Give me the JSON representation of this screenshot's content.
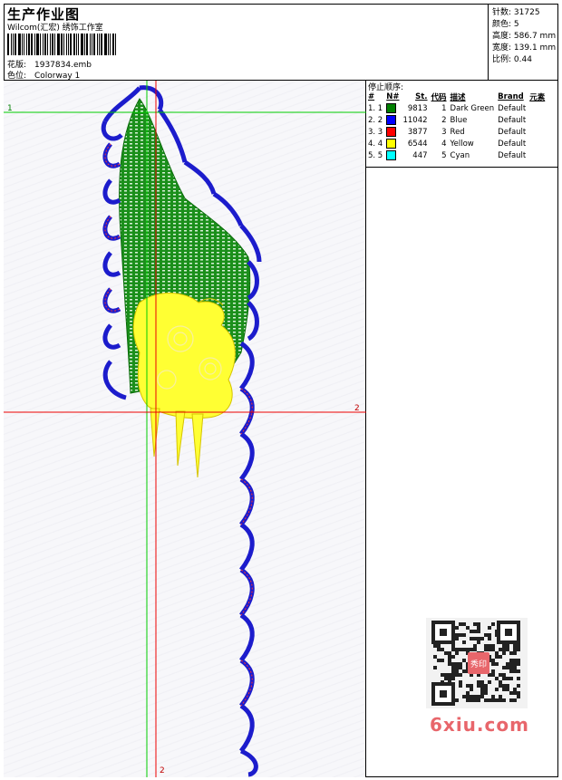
{
  "header": {
    "title": "生产作业图",
    "subtitle": "Wilcom(汇宏) 绣饰工作室",
    "design_label": "花版:",
    "design_file": "1937834.emb",
    "colorway_label": "色位:",
    "colorway": "Colorway 1"
  },
  "stats": [
    {
      "label": "针数:",
      "value": "31725"
    },
    {
      "label": "颜色:",
      "value": "5"
    },
    {
      "label": "高度:",
      "value": "586.7 mm"
    },
    {
      "label": "宽度:",
      "value": "139.1 mm"
    },
    {
      "label": "比例:",
      "value": "0.44"
    }
  ],
  "panel": {
    "title": "停止顺序:",
    "headers": [
      "#",
      "N#",
      "St.",
      "代码",
      "描述",
      "Brand",
      "元素"
    ],
    "rows": [
      {
        "idx": "1. 1",
        "color": "#008000",
        "stitches": "9813",
        "code": "1",
        "desc": "Dark Green",
        "brand": "Default"
      },
      {
        "idx": "2. 2",
        "color": "#0000ff",
        "stitches": "11042",
        "code": "2",
        "desc": "Blue",
        "brand": "Default"
      },
      {
        "idx": "3. 3",
        "color": "#ff0000",
        "stitches": "3877",
        "code": "3",
        "desc": "Red",
        "brand": "Default"
      },
      {
        "idx": "4. 4",
        "color": "#ffff00",
        "stitches": "6544",
        "code": "4",
        "desc": "Yellow",
        "brand": "Default"
      },
      {
        "idx": "5. 5",
        "color": "#00ffff",
        "stitches": "447",
        "code": "5",
        "desc": "Cyan",
        "brand": "Default"
      }
    ]
  },
  "axes": {
    "h1": "1",
    "v1": "2",
    "h2": "2",
    "v2": "2"
  },
  "watermark": "6xiu.com",
  "qr_badge": "秀印"
}
